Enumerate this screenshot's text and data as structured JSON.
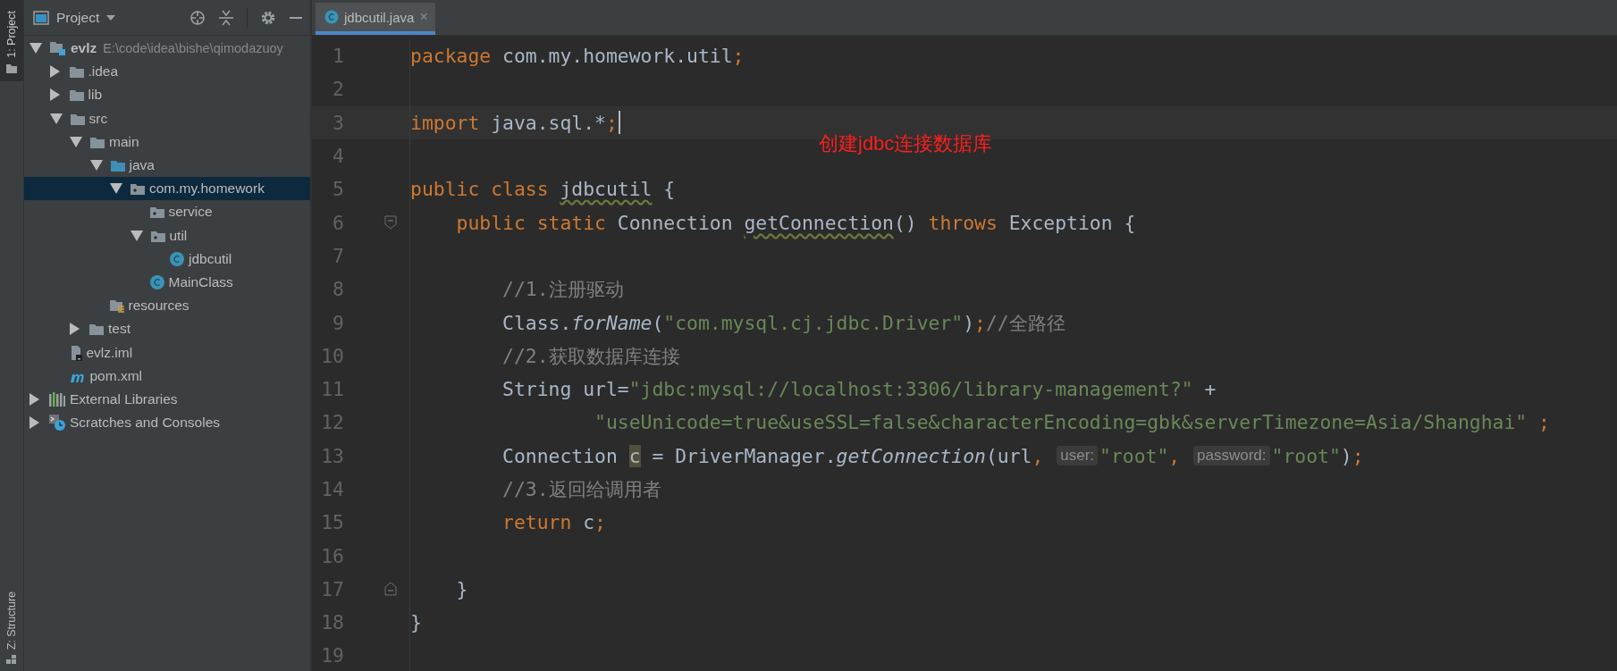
{
  "tool_strip": {
    "top_tab": {
      "label": "1: Project",
      "selected": true
    },
    "bottom_tab": {
      "label": "Z: Structure",
      "selected": false
    }
  },
  "project_panel": {
    "title": "Project",
    "tree": [
      {
        "label": "evlz",
        "note": "E:\\code\\idea\\bishe\\qimodazuoy",
        "kind": "module",
        "expanded": true,
        "selected": false,
        "children": [
          {
            "label": ".idea",
            "kind": "folder",
            "expanded": false,
            "selected": false
          },
          {
            "label": "lib",
            "kind": "folder",
            "expanded": false,
            "selected": false
          },
          {
            "label": "src",
            "kind": "folder",
            "expanded": true,
            "selected": false,
            "children": [
              {
                "label": "main",
                "kind": "folder",
                "expanded": true,
                "selected": false,
                "children": [
                  {
                    "label": "java",
                    "kind": "source-folder",
                    "expanded": true,
                    "selected": false,
                    "children": [
                      {
                        "label": "com.my.homework",
                        "kind": "package",
                        "expanded": true,
                        "selected": true,
                        "children": [
                          {
                            "label": "service",
                            "kind": "package",
                            "selected": false
                          },
                          {
                            "label": "util",
                            "kind": "package",
                            "expanded": true,
                            "selected": false,
                            "children": [
                              {
                                "label": "jdbcutil",
                                "kind": "class",
                                "selected": false
                              }
                            ]
                          },
                          {
                            "label": "MainClass",
                            "kind": "class",
                            "selected": false
                          }
                        ]
                      }
                    ]
                  },
                  {
                    "label": "resources",
                    "kind": "resources",
                    "selected": false
                  }
                ]
              },
              {
                "label": "test",
                "kind": "folder",
                "expanded": false,
                "selected": false
              }
            ]
          },
          {
            "label": "evlz.iml",
            "kind": "module-file",
            "selected": false
          },
          {
            "label": "pom.xml",
            "kind": "maven",
            "selected": false
          }
        ]
      },
      {
        "label": "External Libraries",
        "kind": "libraries",
        "expanded": false,
        "selected": false
      },
      {
        "label": "Scratches and Consoles",
        "kind": "scratches",
        "expanded": false,
        "selected": false
      }
    ]
  },
  "editor": {
    "tabs": [
      {
        "label": "jdbcutil.java",
        "selected": true,
        "close": "×"
      }
    ],
    "annotation": "创建jdbc连接数据库",
    "lines": [
      {
        "number": "1",
        "tokens": [
          {
            "kind": "keyword",
            "text": "package"
          },
          {
            "kind": "plain",
            "text": " com.my.homework.util"
          },
          {
            "kind": "punct",
            "text": ";"
          }
        ]
      },
      {
        "number": "2"
      },
      {
        "number": "3",
        "current": true,
        "caret": true,
        "tokens": [
          {
            "kind": "keyword",
            "text": "import"
          },
          {
            "kind": "plain",
            "text": " java.sql.*"
          },
          {
            "kind": "punct",
            "text": ";"
          }
        ]
      },
      {
        "number": "4"
      },
      {
        "number": "5",
        "tokens": [
          {
            "kind": "keyword",
            "text": "public class "
          },
          {
            "kind": "unused",
            "text": "jdbcutil"
          },
          {
            "kind": "plain",
            "text": " {"
          }
        ]
      },
      {
        "number": "6",
        "fold_start": true,
        "tokens": [
          {
            "kind": "keyword",
            "text": "    public static"
          },
          {
            "kind": "plain",
            "text": " Connection "
          },
          {
            "kind": "unused",
            "text": "getConnection"
          },
          {
            "kind": "plain",
            "text": "() "
          },
          {
            "kind": "keyword",
            "text": "throws"
          },
          {
            "kind": "plain",
            "text": " Exception {"
          }
        ]
      },
      {
        "number": "7"
      },
      {
        "number": "8",
        "tokens": [
          {
            "kind": "comment",
            "text": "        //1.注册驱动"
          }
        ]
      },
      {
        "number": "9",
        "tokens": [
          {
            "kind": "plain",
            "text": "        Class."
          },
          {
            "kind": "static-call",
            "text": "forName"
          },
          {
            "kind": "plain",
            "text": "("
          },
          {
            "kind": "string",
            "text": "\"com.mysql.cj.jdbc.Driver\""
          },
          {
            "kind": "plain",
            "text": ")"
          },
          {
            "kind": "punct",
            "text": ";"
          },
          {
            "kind": "comment",
            "text": "//全路径"
          }
        ]
      },
      {
        "number": "10",
        "tokens": [
          {
            "kind": "comment",
            "text": "        //2.获取数据库连接"
          }
        ]
      },
      {
        "number": "11",
        "tokens": [
          {
            "kind": "plain",
            "text": "        String url="
          },
          {
            "kind": "string",
            "text": "\"jdbc:mysql://localhost:3306/library-management?\""
          },
          {
            "kind": "plain",
            "text": " +"
          }
        ]
      },
      {
        "number": "12",
        "tokens": [
          {
            "kind": "string",
            "text": "                \"useUnicode=true&useSSL=false&characterEncoding=gbk&serverTimezone=Asia/Shanghai\""
          },
          {
            "kind": "punct",
            "text": " ;"
          }
        ]
      },
      {
        "number": "13",
        "tokens": [
          {
            "kind": "plain",
            "text": "        Connection "
          },
          {
            "kind": "highlight",
            "text": "c"
          },
          {
            "kind": "plain",
            "text": " = DriverManager."
          },
          {
            "kind": "static-call",
            "text": "getConnection"
          },
          {
            "kind": "plain",
            "text": "(url"
          },
          {
            "kind": "punct",
            "text": ", "
          },
          {
            "kind": "hint",
            "text": "user:"
          },
          {
            "kind": "string",
            "text": "\"root\""
          },
          {
            "kind": "punct",
            "text": ", "
          },
          {
            "kind": "hint",
            "text": "password:"
          },
          {
            "kind": "string",
            "text": "\"root\""
          },
          {
            "kind": "plain",
            "text": ")"
          },
          {
            "kind": "punct",
            "text": ";"
          }
        ]
      },
      {
        "number": "14",
        "tokens": [
          {
            "kind": "comment",
            "text": "        //3.返回给调用者"
          }
        ]
      },
      {
        "number": "15",
        "tokens": [
          {
            "kind": "keyword",
            "text": "        return"
          },
          {
            "kind": "plain",
            "text": " c"
          },
          {
            "kind": "punct",
            "text": ";"
          }
        ]
      },
      {
        "number": "16"
      },
      {
        "number": "17",
        "fold_end": true,
        "tokens": [
          {
            "kind": "plain",
            "text": "    }"
          }
        ]
      },
      {
        "number": "18",
        "tokens": [
          {
            "kind": "plain",
            "text": "}"
          }
        ]
      },
      {
        "number": "19"
      }
    ]
  }
}
